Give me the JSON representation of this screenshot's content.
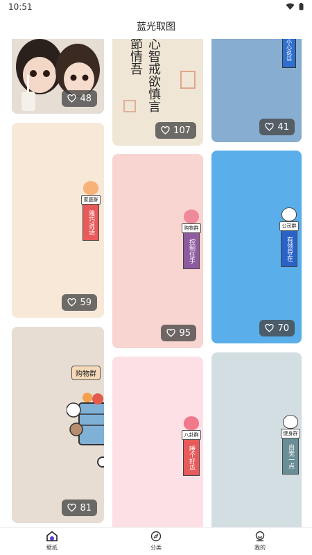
{
  "status": {
    "time": "10:51"
  },
  "app": {
    "title": "蓝光取图"
  },
  "colors": {
    "accent": "#5b3bd6",
    "like_badge_bg": "#464646"
  },
  "cards": [
    {
      "likes": "48"
    },
    {
      "likes": "107",
      "calligraphy": [
        "心",
        "智",
        "戒",
        "欲",
        "慎",
        "言",
        "節",
        "情",
        "吾"
      ]
    },
    {
      "likes": "41",
      "sign_text": "小心说话"
    },
    {
      "likes": "59",
      "sign_tag": "家庭群",
      "sign_text": "雅巧说话"
    },
    {
      "likes": "95",
      "sign_tag": "购物群",
      "sign_text": "控制住手"
    },
    {
      "likes": "70",
      "sign_tag": "公司群",
      "sign_text": "有领导在"
    },
    {
      "likes": "81",
      "banner": "购物群"
    },
    {
      "sign_tag": "八卦群",
      "sign_text": "睡个好瓜"
    },
    {
      "sign_tag": "健身群",
      "sign_text": "自觉一点"
    }
  ],
  "tabs": [
    {
      "label": "壁纸",
      "icon": "home-icon",
      "active": true
    },
    {
      "label": "分类",
      "icon": "compass-icon",
      "active": false
    },
    {
      "label": "我的",
      "icon": "profile-icon",
      "active": false
    }
  ]
}
